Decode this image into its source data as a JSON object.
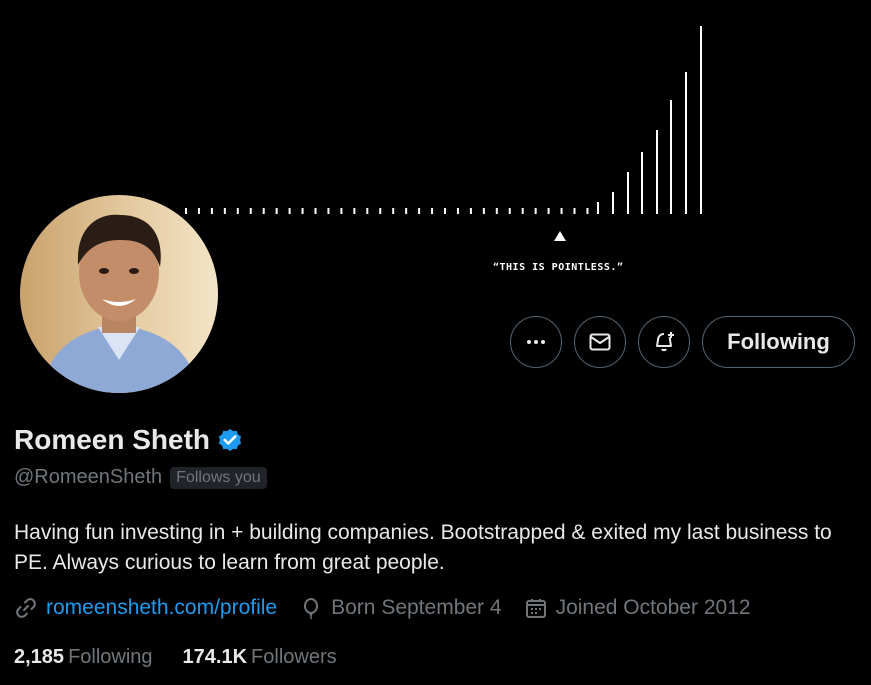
{
  "banner": {
    "caption": "“THIS IS POINTLESS.”"
  },
  "profile": {
    "name": "Romeen Sheth",
    "handle": "@RomeenSheth",
    "follows_you": "Follows you",
    "verified": true,
    "bio": "Having fun investing in + building companies. Bootstrapped & exited my last business to PE.  Always curious to learn from great people.",
    "website": "romeensheth.com/profile",
    "birthday": "Born September 4",
    "joined": "Joined October 2012"
  },
  "actions": {
    "more_icon": "more-icon",
    "message_icon": "mail-icon",
    "notify_icon": "bell-plus-icon",
    "following_label": "Following"
  },
  "stats": {
    "following_count": "2,185",
    "following_label": "Following",
    "followers_count": "174.1K",
    "followers_label": "Followers"
  },
  "colors": {
    "background": "#000000",
    "text": "#e7e9ea",
    "muted": "#71767b",
    "link": "#1d9bf0",
    "verified": "#1d9bf0",
    "border": "#536471"
  }
}
